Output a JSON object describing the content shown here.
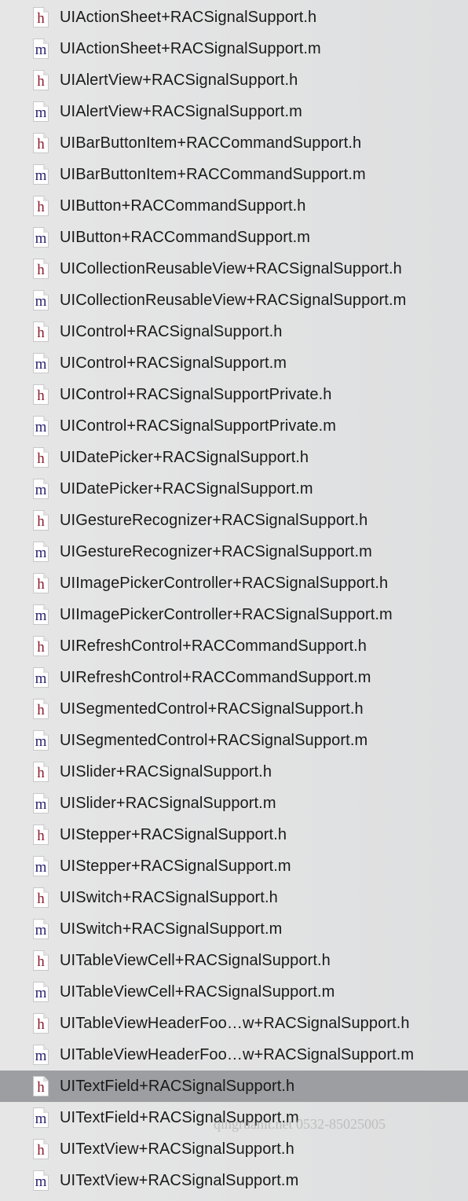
{
  "files": [
    {
      "name": "UIActionSheet+RACSignalSupport.h",
      "type": "h"
    },
    {
      "name": "UIActionSheet+RACSignalSupport.m",
      "type": "m"
    },
    {
      "name": "UIAlertView+RACSignalSupport.h",
      "type": "h"
    },
    {
      "name": "UIAlertView+RACSignalSupport.m",
      "type": "m"
    },
    {
      "name": "UIBarButtonItem+RACCommandSupport.h",
      "type": "h"
    },
    {
      "name": "UIBarButtonItem+RACCommandSupport.m",
      "type": "m"
    },
    {
      "name": "UIButton+RACCommandSupport.h",
      "type": "h"
    },
    {
      "name": "UIButton+RACCommandSupport.m",
      "type": "m"
    },
    {
      "name": "UICollectionReusableView+RACSignalSupport.h",
      "type": "h"
    },
    {
      "name": "UICollectionReusableView+RACSignalSupport.m",
      "type": "m"
    },
    {
      "name": "UIControl+RACSignalSupport.h",
      "type": "h"
    },
    {
      "name": "UIControl+RACSignalSupport.m",
      "type": "m"
    },
    {
      "name": "UIControl+RACSignalSupportPrivate.h",
      "type": "h"
    },
    {
      "name": "UIControl+RACSignalSupportPrivate.m",
      "type": "m"
    },
    {
      "name": "UIDatePicker+RACSignalSupport.h",
      "type": "h"
    },
    {
      "name": "UIDatePicker+RACSignalSupport.m",
      "type": "m"
    },
    {
      "name": "UIGestureRecognizer+RACSignalSupport.h",
      "type": "h"
    },
    {
      "name": "UIGestureRecognizer+RACSignalSupport.m",
      "type": "m"
    },
    {
      "name": "UIImagePickerController+RACSignalSupport.h",
      "type": "h"
    },
    {
      "name": "UIImagePickerController+RACSignalSupport.m",
      "type": "m"
    },
    {
      "name": "UIRefreshControl+RACCommandSupport.h",
      "type": "h"
    },
    {
      "name": "UIRefreshControl+RACCommandSupport.m",
      "type": "m"
    },
    {
      "name": "UISegmentedControl+RACSignalSupport.h",
      "type": "h"
    },
    {
      "name": "UISegmentedControl+RACSignalSupport.m",
      "type": "m"
    },
    {
      "name": "UISlider+RACSignalSupport.h",
      "type": "h"
    },
    {
      "name": "UISlider+RACSignalSupport.m",
      "type": "m"
    },
    {
      "name": "UIStepper+RACSignalSupport.h",
      "type": "h"
    },
    {
      "name": "UIStepper+RACSignalSupport.m",
      "type": "m"
    },
    {
      "name": "UISwitch+RACSignalSupport.h",
      "type": "h"
    },
    {
      "name": "UISwitch+RACSignalSupport.m",
      "type": "m"
    },
    {
      "name": "UITableViewCell+RACSignalSupport.h",
      "type": "h"
    },
    {
      "name": "UITableViewCell+RACSignalSupport.m",
      "type": "m"
    },
    {
      "name": "UITableViewHeaderFoo…w+RACSignalSupport.h",
      "type": "h"
    },
    {
      "name": "UITableViewHeaderFoo…w+RACSignalSupport.m",
      "type": "m"
    },
    {
      "name": "UITextField+RACSignalSupport.h",
      "type": "h",
      "selected": true
    },
    {
      "name": "UITextField+RACSignalSupport.m",
      "type": "m"
    },
    {
      "name": "UITextView+RACSignalSupport.h",
      "type": "h"
    },
    {
      "name": "UITextView+RACSignalSupport.m",
      "type": "m"
    }
  ],
  "watermark": "qingruanit.net 0532-85025005",
  "colors": {
    "selected_row": "#9c9ea1",
    "header_icon": "#8b1a2b",
    "impl_icon": "#2a2470"
  }
}
